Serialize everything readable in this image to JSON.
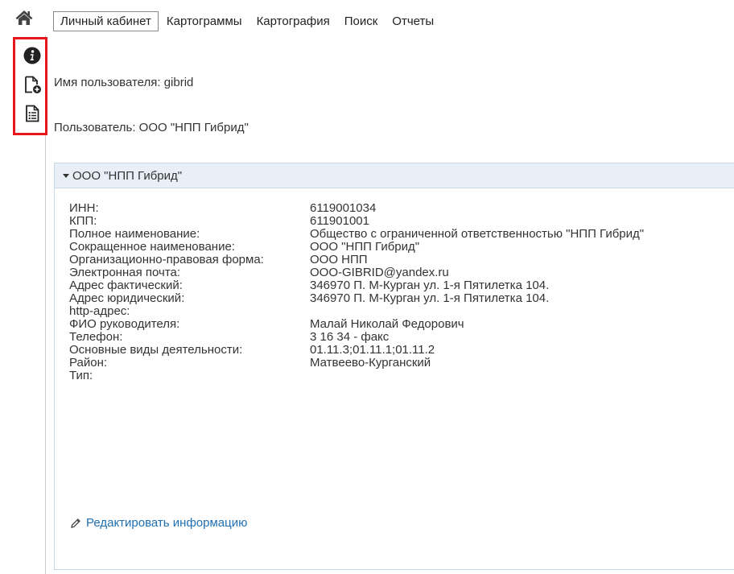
{
  "nav": {
    "home_icon": "home-icon",
    "tabs": [
      {
        "label": "Личный кабинет",
        "active": true
      },
      {
        "label": "Картограммы",
        "active": false
      },
      {
        "label": "Картография",
        "active": false
      },
      {
        "label": "Поиск",
        "active": false
      },
      {
        "label": "Отчеты",
        "active": false
      }
    ]
  },
  "toolbox": {
    "highlight_color": "#e8151a",
    "icons": [
      "info-icon",
      "add-file-icon",
      "document-list-icon"
    ]
  },
  "user": {
    "username_line": "Имя пользователя: gibrid",
    "user_line": "Пользователь: ООО \"НПП Гибрид\""
  },
  "panel": {
    "title": "ООО \"НПП Гибрид\"",
    "fields": [
      {
        "key": "ИНН:",
        "value": "6119001034"
      },
      {
        "key": "КПП:",
        "value": "611901001"
      },
      {
        "key": "Полное наименование:",
        "value": "Общество с ограниченной ответственностью \"НПП Гибрид\""
      },
      {
        "key": "Сокращенное наименование:",
        "value": "ООО \"НПП Гибрид\""
      },
      {
        "key": "Организационно-правовая форма:",
        "value": "ООО НПП"
      },
      {
        "key": "Электронная почта:",
        "value": "OOO-GIBRID@yandex.ru"
      },
      {
        "key": "Адрес фактический:",
        "value": "346970 П. М-Курган ул. 1-я Пятилетка 104."
      },
      {
        "key": "Адрес юридический:",
        "value": "346970 П. М-Курган ул. 1-я Пятилетка 104."
      },
      {
        "key": "http-адрес:",
        "value": ""
      },
      {
        "key": "ФИО руководителя:",
        "value": "Малай Николай Федорович"
      },
      {
        "key": "Телефон:",
        "value": "3 16 34 - факс"
      },
      {
        "key": "Основные виды деятельности:",
        "value": "01.11.3;01.11.1;01.11.2"
      },
      {
        "key": "Район:",
        "value": "Матвеево-Курганский"
      },
      {
        "key": "Тип:",
        "value": ""
      }
    ],
    "edit_label": "Редактировать информацию",
    "link_color": "#1f6fb2"
  }
}
